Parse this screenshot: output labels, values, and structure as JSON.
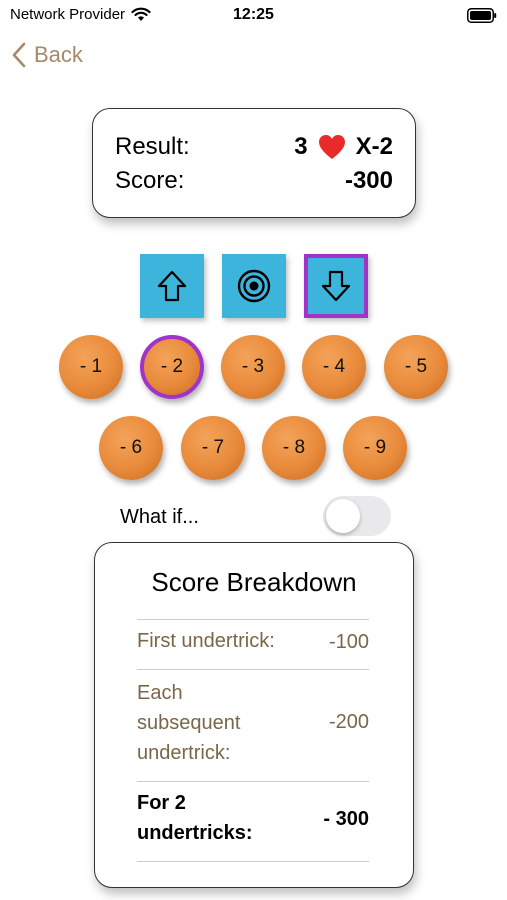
{
  "status_bar": {
    "carrier": "Network Provider",
    "time": "12:25"
  },
  "nav": {
    "back_label": "Back"
  },
  "result": {
    "result_label": "Result:",
    "result_level": "3",
    "result_suit": "heart",
    "result_outcome": "X-2",
    "score_label": "Score:",
    "score_value": "-300"
  },
  "direction_buttons": [
    {
      "icon": "arrow-up-icon",
      "selected": false
    },
    {
      "icon": "target-icon",
      "selected": false
    },
    {
      "icon": "arrow-down-icon",
      "selected": true
    }
  ],
  "undertrick_buttons": [
    {
      "label": "- 1",
      "selected": false
    },
    {
      "label": "- 2",
      "selected": true
    },
    {
      "label": "- 3",
      "selected": false
    },
    {
      "label": "- 4",
      "selected": false
    },
    {
      "label": "- 5",
      "selected": false
    },
    {
      "label": "- 6",
      "selected": false
    },
    {
      "label": "- 7",
      "selected": false
    },
    {
      "label": "- 8",
      "selected": false
    },
    {
      "label": "- 9",
      "selected": false
    }
  ],
  "what_if": {
    "label": "What if...",
    "enabled": false
  },
  "breakdown": {
    "title": "Score Breakdown",
    "rows": [
      {
        "label": "First undertrick:",
        "value": "-100"
      },
      {
        "label": "Each subsequent undertrick:",
        "value": "-200"
      }
    ],
    "total": {
      "label": "For 2 undertricks:",
      "value": "- 300"
    }
  },
  "colors": {
    "accent_blue": "#3cb4dc",
    "selection_purple": "#a033c8",
    "ball_orange": "#e88a3a",
    "label_brown": "#7a6649",
    "heart_red": "#e82a2a"
  }
}
